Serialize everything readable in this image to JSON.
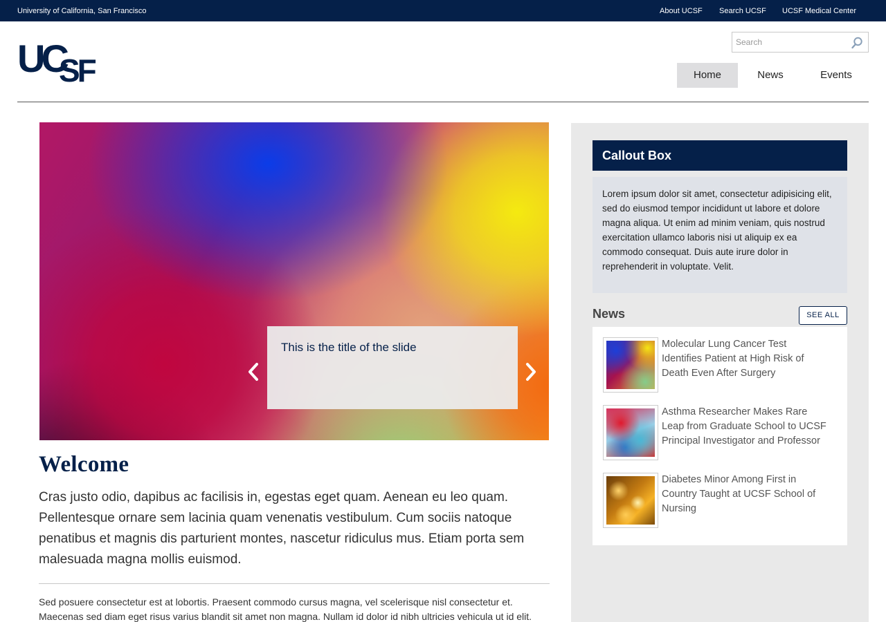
{
  "utility_bar": {
    "org_name": "University of California, San Francisco",
    "links": [
      "About UCSF",
      "Search UCSF",
      "UCSF Medical Center"
    ]
  },
  "header": {
    "logo_text": "UCSF",
    "search": {
      "placeholder": "Search",
      "value": ""
    },
    "nav": [
      "Home",
      "News",
      "Events"
    ],
    "active_nav": "Home"
  },
  "slideshow": {
    "slide_title": "This is the title of the slide"
  },
  "main": {
    "welcome_title": "Welcome",
    "lead": "Cras justo odio, dapibus ac facilisis in, egestas eget quam. Aenean eu leo quam. Pellentesque ornare sem lacinia quam venenatis vestibulum. Cum sociis natoque penatibus et magnis dis parturient montes, nascetur ridiculus mus. Etiam porta sem malesuada magna mollis euismod.",
    "body": "Sed posuere consectetur est at lobortis. Praesent commodo cursus magna, vel scelerisque nisl consectetur et. Maecenas sed diam eget risus varius blandit sit amet non magna. Nullam id dolor id nibh ultricies vehicula ut id elit."
  },
  "sidebar": {
    "callout_title": "Callout Box",
    "callout_body": "Lorem ipsum dolor sit amet, consectetur adipisicing elit, sed do eiusmod tempor incididunt ut labore et dolore magna aliqua. Ut enim ad minim veniam, quis nostrud exercitation ullamco laboris nisi ut aliquip ex ea commodo consequat. Duis aute irure dolor in reprehenderit in voluptate. Velit.",
    "news_heading": "News",
    "see_all_label": "SEE ALL",
    "news_items": [
      {
        "headline": "Molecular Lung Cancer Test Identifies Patient at High Risk of Death Even After Surgery"
      },
      {
        "headline": "Asthma Researcher Makes Rare Leap from Graduate School to UCSF Principal Investigator and Professor"
      },
      {
        "headline": "Diabetes Minor Among First in Country Taught at UCSF School of Nursing"
      }
    ]
  },
  "colors": {
    "brand_navy": "#052049",
    "sidebar_bg": "#e9e9e9",
    "callout_bg": "#dfe2e8"
  }
}
